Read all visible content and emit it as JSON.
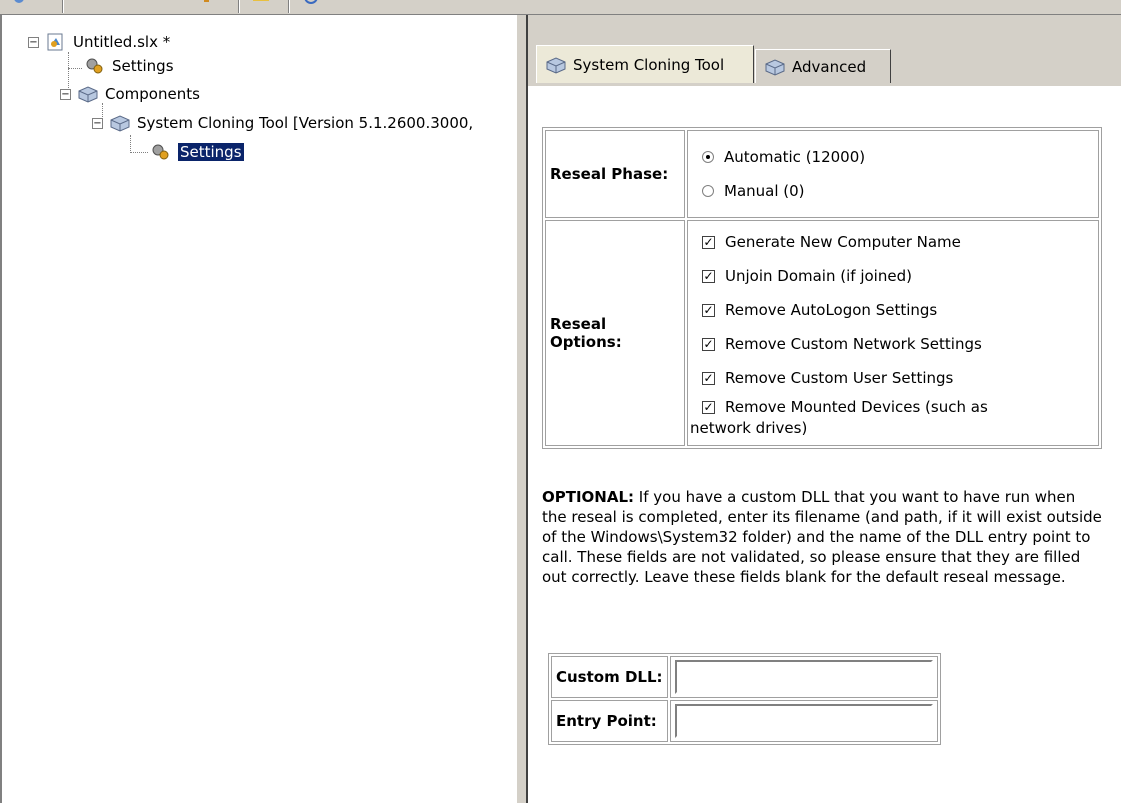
{
  "tree": {
    "root_label": "Untitled.slx *",
    "settings_label": "Settings",
    "components_label": "Components",
    "tool_label": "System Cloning Tool [Version 5.1.2600.3000,",
    "tool_settings_label": "Settings",
    "expander_minus": "−"
  },
  "tabs": [
    {
      "label": "System Cloning Tool"
    },
    {
      "label": "Advanced"
    }
  ],
  "reseal_phase": {
    "label": "Reseal Phase:",
    "options": [
      {
        "label": "Automatic (12000)",
        "selected": true
      },
      {
        "label": "Manual (0)",
        "selected": false
      }
    ]
  },
  "reseal_options": {
    "label_line1": "Reseal",
    "label_line2": "Options:",
    "items": [
      {
        "label": "Generate New Computer Name",
        "checked": true
      },
      {
        "label": "Unjoin Domain (if joined)",
        "checked": true
      },
      {
        "label": "Remove AutoLogon Settings",
        "checked": true
      },
      {
        "label": "Remove Custom Network Settings",
        "checked": true
      },
      {
        "label": "Remove Custom User Settings",
        "checked": true
      },
      {
        "label": "Remove Mounted Devices (such as",
        "label_cont": "network drives)",
        "checked": true
      }
    ]
  },
  "optional": {
    "bold": "OPTIONAL:",
    "text": " If you have a custom DLL that you want to have run when the reseal is completed, enter its filename (and path, if it will exist outside of the Windows\\System32 folder) and the name of the DLL entry point to call. These fields are not validated, so please ensure that they are filled out correctly. Leave these fields blank for the default reseal message."
  },
  "fields": {
    "custom_dll_label": "Custom DLL:",
    "custom_dll_value": "",
    "entry_point_label": "Entry Point:",
    "entry_point_value": ""
  },
  "colors": {
    "selection": "#0a246a",
    "chrome": "#d4d0c8"
  }
}
